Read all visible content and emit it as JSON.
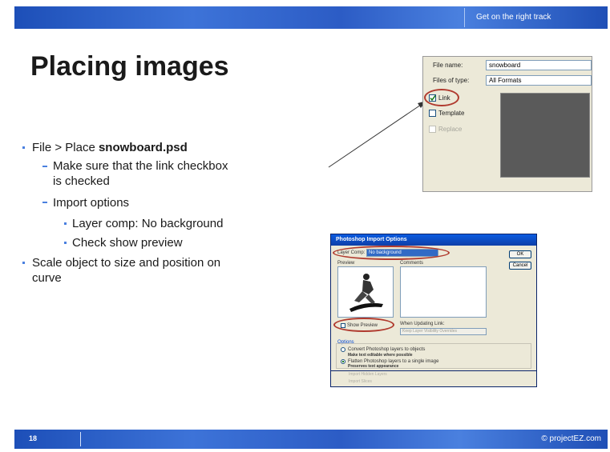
{
  "header": {
    "tagline": "Get on the right track"
  },
  "footer": {
    "slide_number": "18",
    "copyright": "© projectEZ.com"
  },
  "title": "Placing images",
  "bullets": {
    "b1_pre": "File > Place ",
    "b1_bold": "snowboard.psd",
    "b2_line1": "Make sure that the link checkbox",
    "b2_line2": "is checked",
    "b3": "Import options",
    "b4": "Layer comp:  No background",
    "b5": "Check show preview",
    "b6_line1": "Scale object to size and position on",
    "b6_line2": "curve"
  },
  "file_dialog": {
    "file_name_label": "File name:",
    "file_name_value": "snowboard",
    "files_of_type_label": "Files of type:",
    "files_of_type_value": "All Formats",
    "link_label": "Link",
    "template_label": "Template",
    "replace_label": "Replace"
  },
  "import_dialog": {
    "title": "Photoshop Import Options",
    "layer_comp_label": "Layer Comp:",
    "layer_comp_value": "No background",
    "preview_label": "Preview",
    "comments_label": "Comments",
    "ok_label": "OK",
    "cancel_label": "Cancel",
    "show_preview_label": "Show Preview",
    "when_updating_label": "When Updating Link:",
    "when_updating_value": "Keep Layer Visibility Overrides",
    "options_label": "Options",
    "convert_label": "Convert Photoshop layers to objects",
    "convert_sub": "Make text editable where possible",
    "flatten_label": "Flatten Photoshop layers to a single image",
    "flatten_sub": "Preserves text appearance",
    "import_hidden_label": "Import Hidden Layers",
    "import_slices_label": "Import Slices"
  },
  "colors": {
    "banner": "#2c5cc5",
    "bullet": "#4a80df",
    "annotation": "#b03a2e"
  }
}
